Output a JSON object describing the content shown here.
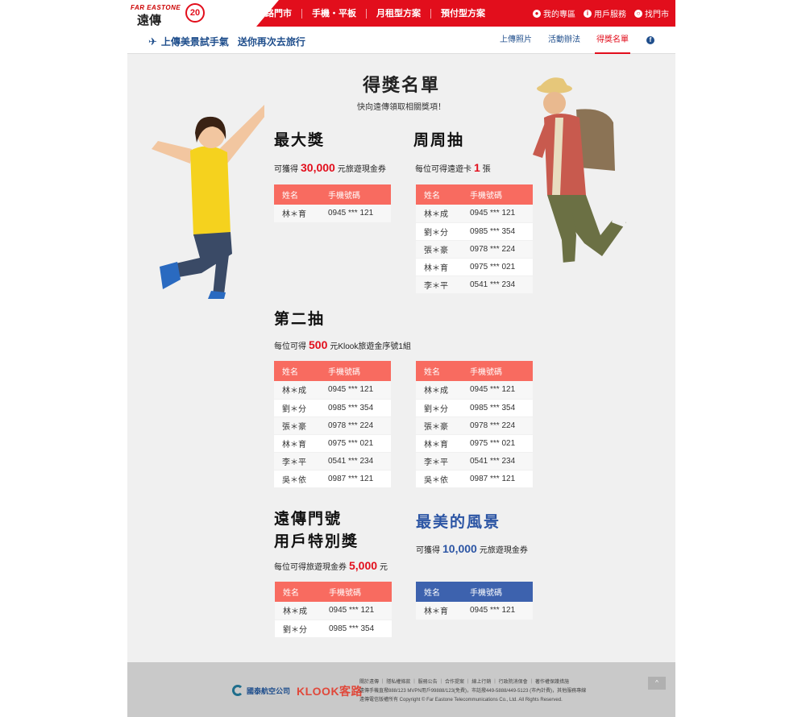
{
  "header": {
    "brand_en": "FAR EASTONE",
    "brand_cn": "遠傳",
    "anniversary": "20",
    "nav": [
      "網路門市",
      "手機・平板",
      "月租型方案",
      "預付型方案"
    ],
    "right_links": [
      "我的專區",
      "用戶服務",
      "找門市"
    ]
  },
  "subnav": {
    "title_a": "上傳美景試手氣",
    "title_b": "送你再次去旅行",
    "links": [
      "上傳照片",
      "活動辦法",
      "得獎名單"
    ],
    "active": "得獎名單",
    "facebook": "f"
  },
  "main": {
    "title": "得獎名單",
    "subtitle": "快向遠傳領取相關獎項！"
  },
  "prizes": {
    "grand": {
      "title": "最大獎",
      "desc_pre": "可獲得",
      "amount": "30,000",
      "desc_post": "元旅遊現金券",
      "headers": [
        "姓名",
        "手機號碼"
      ],
      "rows": [
        [
          "林＊育",
          "0945 *** 121"
        ]
      ]
    },
    "weekly": {
      "title": "周周抽",
      "desc_pre": "每位可得遠遊卡",
      "amount": "1",
      "desc_post": "張",
      "headers": [
        "姓名",
        "手機號碼"
      ],
      "rows": [
        [
          "林＊成",
          "0945 *** 121"
        ],
        [
          "劉＊分",
          "0985 *** 354"
        ],
        [
          "張＊豪",
          "0978 *** 224"
        ],
        [
          "林＊育",
          "0975 *** 021"
        ],
        [
          "李＊平",
          "0541 *** 234"
        ]
      ]
    },
    "second": {
      "title": "第二抽",
      "desc_pre": "每位可得",
      "amount": "500",
      "desc_post": "元Klook旅遊金序號1組",
      "headers": [
        "姓名",
        "手機號碼"
      ],
      "rows_left": [
        [
          "林＊成",
          "0945 *** 121"
        ],
        [
          "劉＊分",
          "0985 *** 354"
        ],
        [
          "張＊豪",
          "0978 *** 224"
        ],
        [
          "林＊育",
          "0975 *** 021"
        ],
        [
          "李＊平",
          "0541 *** 234"
        ],
        [
          "吳＊依",
          "0987 *** 121"
        ]
      ],
      "rows_right": [
        [
          "林＊成",
          "0945 *** 121"
        ],
        [
          "劉＊分",
          "0985 *** 354"
        ],
        [
          "張＊豪",
          "0978 *** 224"
        ],
        [
          "林＊育",
          "0975 *** 021"
        ],
        [
          "李＊平",
          "0541 *** 234"
        ],
        [
          "吳＊依",
          "0987 *** 121"
        ]
      ]
    },
    "special": {
      "title_line1": "遠傳門號",
      "title_line2": "用戶特別獎",
      "desc_pre": "每位可得旅遊現金券",
      "amount": "5,000",
      "desc_post": "元",
      "headers": [
        "姓名",
        "手機號碼"
      ],
      "rows": [
        [
          "林＊成",
          "0945 *** 121"
        ],
        [
          "劉＊分",
          "0985 *** 354"
        ]
      ]
    },
    "scenery": {
      "title": "最美的風景",
      "desc_pre": "可獲得",
      "amount": "10,000",
      "desc_post": "元旅遊現金券",
      "headers": [
        "姓名",
        "手機號碼"
      ],
      "rows": [
        [
          "林＊育",
          "0945 *** 121"
        ]
      ]
    }
  },
  "footer": {
    "partner1": "國泰航空公司",
    "partner2": "KLOOK客路",
    "links_line1": "關於遠傳 ｜ 隱私權條款 ｜ 服務公告 ｜ 合作提案 ｜ 線上行銷 ｜ 行政院消保會 ｜ 著作權保護措施",
    "links_line2": "遠傳手機直撥888/123 MVPN用戶99888/123(免費)，市話撥449-5888/449-5123 (市內計費)，其他服務專線",
    "links_line3": "遠傳電信版權所有 Copyright © Far Eastone Telecommunications Co., Ltd. All Rights Reserved.",
    "to_top": "^"
  },
  "colors": {
    "brand_red": "#e20e1c",
    "table_header": "#f86b60",
    "table_header_blue": "#3d62ae",
    "navy": "#1f4e8c"
  }
}
